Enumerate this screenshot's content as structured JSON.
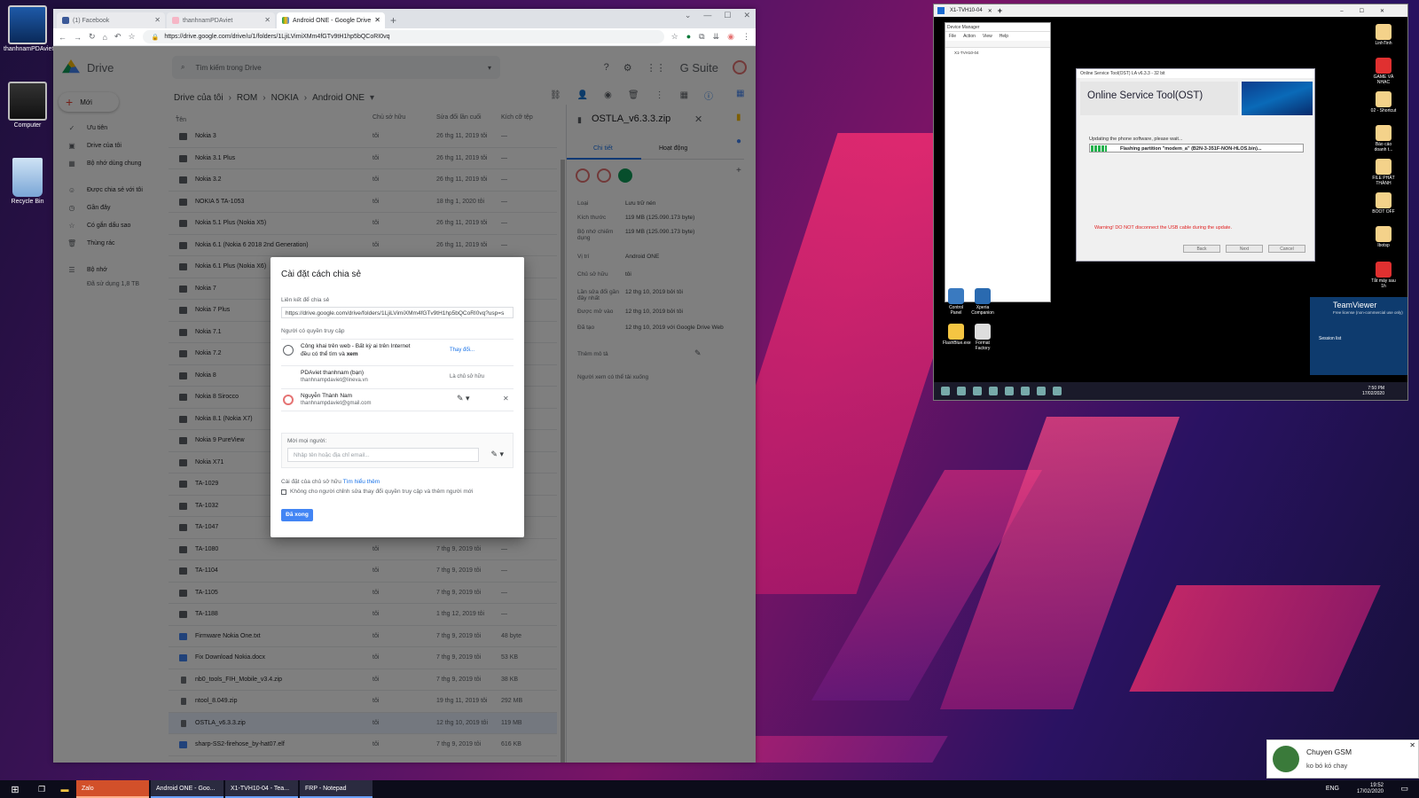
{
  "desktop": {
    "icons": [
      {
        "label": "thanhnamPDAviet"
      },
      {
        "label": "Computer"
      },
      {
        "label": "Recycle Bin"
      }
    ]
  },
  "chrome": {
    "tabs": [
      {
        "title": "(1) Facebook"
      },
      {
        "title": "thanhnamPDAviet"
      },
      {
        "title": "Android ONE - Google Drive"
      }
    ],
    "url": "https://drive.google.com/drive/u/1/folders/1LjiLVimiXMm4fGTv9tH1hp5bQCoRI0vq"
  },
  "drive": {
    "logo": "Drive",
    "search_placeholder": "Tìm kiếm trong Drive",
    "gsuite": "G Suite",
    "new": "Mới",
    "sidebar": [
      "Ưu tiên",
      "Drive của tôi",
      "Bộ nhớ dùng chung",
      "Được chia sẻ với tôi",
      "Gần đây",
      "Có gắn dấu sao",
      "Thùng rác",
      "Bộ nhớ",
      "Đã sử dụng 1,8 TB"
    ],
    "breadcrumb": [
      "Drive của tôi",
      "ROM",
      "NOKIA",
      "Android ONE"
    ],
    "columns": {
      "name": "Tên",
      "owner": "Chủ sở hữu",
      "modified": "Sửa đổi lần cuối",
      "size": "Kích cỡ tệp"
    },
    "files": [
      {
        "name": "Nokia 3",
        "owner": "tôi",
        "modified": "26 thg 11, 2019 tôi",
        "size": "—",
        "type": "folder"
      },
      {
        "name": "Nokia 3.1 Plus",
        "owner": "tôi",
        "modified": "26 thg 11, 2019 tôi",
        "size": "—",
        "type": "folder"
      },
      {
        "name": "Nokia 3.2",
        "owner": "tôi",
        "modified": "26 thg 11, 2019 tôi",
        "size": "—",
        "type": "folder"
      },
      {
        "name": "NOKIA 5 TA-1053",
        "owner": "tôi",
        "modified": "18 thg 1, 2020 tôi",
        "size": "—",
        "type": "folder"
      },
      {
        "name": "Nokia 5.1 Plus (Nokia X5)",
        "owner": "tôi",
        "modified": "26 thg 11, 2019 tôi",
        "size": "—",
        "type": "folder"
      },
      {
        "name": "Nokia 6.1 (Nokia 6 2018 2nd Generation)",
        "owner": "tôi",
        "modified": "26 thg 11, 2019 tôi",
        "size": "—",
        "type": "folder"
      },
      {
        "name": "Nokia 6.1 Plus (Nokia X6)",
        "owner": "tôi",
        "modified": "",
        "size": "",
        "type": "folder"
      },
      {
        "name": "Nokia 7",
        "owner": "",
        "modified": "",
        "size": "",
        "type": "folder"
      },
      {
        "name": "Nokia 7 Plus",
        "owner": "",
        "modified": "",
        "size": "",
        "type": "folder"
      },
      {
        "name": "Nokia 7.1",
        "owner": "",
        "modified": "",
        "size": "",
        "type": "folder"
      },
      {
        "name": "Nokia 7.2",
        "owner": "",
        "modified": "",
        "size": "",
        "type": "folder"
      },
      {
        "name": "Nokia 8",
        "owner": "",
        "modified": "",
        "size": "",
        "type": "folder"
      },
      {
        "name": "Nokia 8 Sirocco",
        "owner": "",
        "modified": "",
        "size": "",
        "type": "folder"
      },
      {
        "name": "Nokia 8.1 (Nokia X7)",
        "owner": "",
        "modified": "",
        "size": "",
        "type": "folder"
      },
      {
        "name": "Nokia 9 PureView",
        "owner": "",
        "modified": "",
        "size": "",
        "type": "folder"
      },
      {
        "name": "Nokia X71",
        "owner": "",
        "modified": "",
        "size": "",
        "type": "folder"
      },
      {
        "name": "TA-1029",
        "owner": "",
        "modified": "",
        "size": "",
        "type": "folder"
      },
      {
        "name": "TA-1032",
        "owner": "",
        "modified": "",
        "size": "",
        "type": "folder"
      },
      {
        "name": "TA-1047",
        "owner": "",
        "modified": "",
        "size": "",
        "type": "folder"
      },
      {
        "name": "TA-1080",
        "owner": "tôi",
        "modified": "7 thg 9, 2019 tôi",
        "size": "—",
        "type": "folder"
      },
      {
        "name": "TA-1104",
        "owner": "tôi",
        "modified": "7 thg 9, 2019 tôi",
        "size": "—",
        "type": "folder"
      },
      {
        "name": "TA-1105",
        "owner": "tôi",
        "modified": "7 thg 9, 2019 tôi",
        "size": "—",
        "type": "folder"
      },
      {
        "name": "TA-1188",
        "owner": "tôi",
        "modified": "1 thg 12, 2019 tôi",
        "size": "—",
        "type": "folder"
      },
      {
        "name": "Firmware Nokia One.txt",
        "owner": "tôi",
        "modified": "7 thg 9, 2019 tôi",
        "size": "48 byte",
        "type": "doc"
      },
      {
        "name": "Fix Download Nokia.docx",
        "owner": "tôi",
        "modified": "7 thg 9, 2019 tôi",
        "size": "53 KB",
        "type": "doc"
      },
      {
        "name": "nb0_tools_FIH_Mobile_v3.4.zip",
        "owner": "tôi",
        "modified": "7 thg 9, 2019 tôi",
        "size": "38 KB",
        "type": "zip"
      },
      {
        "name": "ntool_8.049.zip",
        "owner": "tôi",
        "modified": "19 thg 11, 2019 tôi",
        "size": "292 MB",
        "type": "zip"
      },
      {
        "name": "OSTLA_v6.3.3.zip",
        "owner": "tôi",
        "modified": "12 thg 10, 2019 tôi",
        "size": "119 MB",
        "type": "zip",
        "selected": true
      },
      {
        "name": "sharp-SS2-firehose_by-hat07.elf",
        "owner": "tôi",
        "modified": "7 thg 9, 2019 tôi",
        "size": "616 KB",
        "type": "doc"
      }
    ],
    "details": {
      "title": "OSTLA_v6.3.3.zip",
      "tab_detail": "Chi tiết",
      "tab_activity": "Hoạt động",
      "rows": [
        {
          "k": "Loại",
          "v": "Lưu trữ nén"
        },
        {
          "k": "Kích thước",
          "v": "119 MB (125.090.173 byte)"
        },
        {
          "k": "Bộ nhớ chiếm dụng",
          "v": "119 MB (125.090.173 byte)"
        },
        {
          "k": "Vị trí",
          "v": "Android ONE"
        },
        {
          "k": "Chủ sở hữu",
          "v": "tôi"
        },
        {
          "k": "Lần sửa đổi gần đây nhất",
          "v": "12 thg 10, 2019 bởi tôi"
        },
        {
          "k": "Được mở vào",
          "v": "12 thg 10, 2019 bởi tôi"
        },
        {
          "k": "Đã tạo",
          "v": "12 thg 10, 2019 với Google Drive Web"
        }
      ],
      "add_desc": "Thêm mô tả",
      "viewers": "Người xem có thể tải xuống"
    }
  },
  "dialog": {
    "title": "Cài đặt cách chia sẻ",
    "link_label": "Liên kết để chia sẻ",
    "link": "https://drive.google.com/drive/folders/1LjiLVimiXMm4fGTv9tH1hp5bQCoRI0vq?usp=s",
    "access_label": "Người có quyền truy cập",
    "public": {
      "line1": "Công khai trên web - Bất kỳ ai trên Internet",
      "line2": "đều có thể tìm và",
      "bold": "xem",
      "change": "Thay đổi..."
    },
    "owner": {
      "name": "PDAviet thanhnam (bạn)",
      "email": "thanhnampdaviet@lineva.vn",
      "role": "Là chủ sở hữu"
    },
    "user": {
      "name": "Nguyễn Thành Nam",
      "email": "thanhnampdaviet@gmail.com"
    },
    "invite_label": "Mời mọi người:",
    "invite_placeholder": "Nhập tên hoặc địa chỉ email...",
    "owner_settings": "Cài đặt của chủ sở hữu",
    "learn_more": "Tìm hiểu thêm",
    "checkbox": "Không cho người chỉnh sửa thay đổi quyền truy cập và thêm người mới",
    "done": "Đã xong"
  },
  "remote": {
    "tab": "X1-TVH10-04",
    "devmgr": {
      "title": "Device Manager",
      "menu": [
        "File",
        "Action",
        "View",
        "Help"
      ],
      "node": "X1-TVH10-04"
    },
    "ost": {
      "title": "Online Service Tool(OST) LA v6.3.3 - 32 bit",
      "banner": "Online Service Tool(OST)",
      "status": "Updating the phone software, please wait...",
      "progress": "Flashing partition \"modem_a\" (B2N-3-351F-NON-HLOS.bin)...",
      "warning": "Warning! DO NOT disconnect the USB cable during the update.",
      "back": "Back",
      "next": "Next",
      "cancel": "Cancel"
    },
    "icons": [
      {
        "label": "LinhTinh"
      },
      {
        "label": "GAME VÀ NHẠC"
      },
      {
        "label": "02 - Shortcut"
      },
      {
        "label": "Báo cáo doanh t..."
      },
      {
        "label": "FILE PHÁT THÀNH"
      },
      {
        "label": "BOOT OFF"
      },
      {
        "label": "Ibotsp"
      },
      {
        "label": "Tắt máy sau 1h"
      },
      {
        "label": "Control Panel"
      },
      {
        "label": "Xperia Companion"
      },
      {
        "label": "FlashBlue.exe"
      },
      {
        "label": "Format Factory"
      }
    ],
    "tv": {
      "title": "TeamViewer",
      "sub": "Free license (non-commercial use only)",
      "session": "Session list"
    },
    "clock": {
      "time": "7:50 PM",
      "date": "17/02/2020"
    }
  },
  "toast": {
    "name": "Chuyen GSM",
    "msg": "ko bó kó chay"
  },
  "taskbar": {
    "apps": [
      "Zalo",
      "Android ONE - Goo...",
      "X1-TVH10-04 - Tea...",
      "FRP - Notepad"
    ],
    "lang": "ENG",
    "time": "19:52",
    "date": "17/02/2020"
  }
}
